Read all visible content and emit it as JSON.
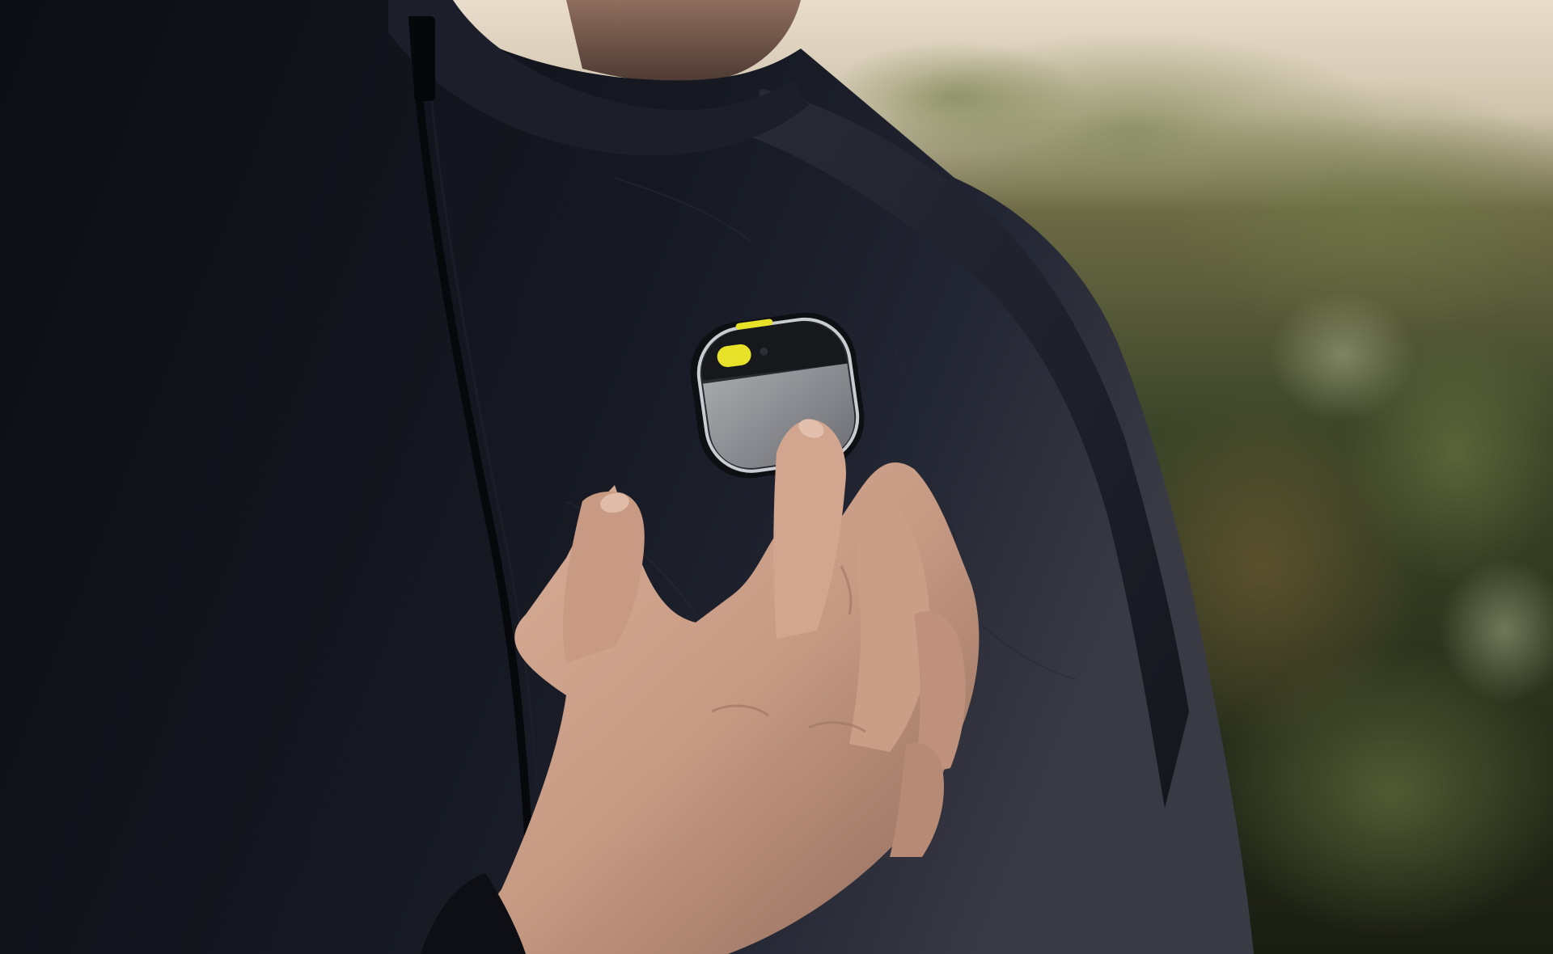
{
  "scene": {
    "subject": "person-in-dark-jacket",
    "device": "lapel-pin-device",
    "colors": {
      "sky": "#e9dccb",
      "foliage": "#3e4a2a",
      "jacket": "#14161d",
      "skin": "#c79a83",
      "device_body": "#2a2c32",
      "device_trim": "#c9ccd1",
      "device_touchpad": "#8d8f93",
      "indicator_light": "#e7e12a"
    }
  }
}
